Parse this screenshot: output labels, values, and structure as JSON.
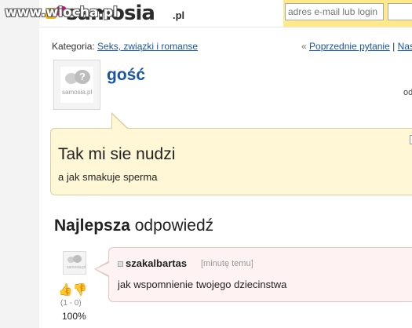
{
  "watermark": "www.wiocha.pl",
  "header": {
    "logo_text": "samosia",
    "logo_tld": ".pl",
    "email_placeholder": "adres e-mail lub login"
  },
  "category": {
    "label": "Kategoria:",
    "value": "Seks, związki i romanse",
    "prev_link": "Poprzednie pytanie",
    "separator": "|",
    "next_link": "Nast"
  },
  "author": {
    "name": "gość",
    "avatar_label": "samosia.pl",
    "side_snippet": "od"
  },
  "question": {
    "title": "Tak mi sie nudzi",
    "body": "a jak smakuje sperma"
  },
  "best_answer": {
    "heading_bold": "Najlepsza",
    "heading_rest": " odpowiedź",
    "user": "szakalbartas",
    "time": "[minutę temu]",
    "text": "jak wspomnienie twojego dziecinstwa",
    "vote_counts": "(1 - 0)",
    "vote_percent": "100%",
    "avatar_label": "samosia.pl"
  },
  "colors": {
    "link": "#1a55a3",
    "question_bg": "#fff7d6",
    "answer_bg": "#fff2f3",
    "login_bg": "#ffe98a"
  }
}
